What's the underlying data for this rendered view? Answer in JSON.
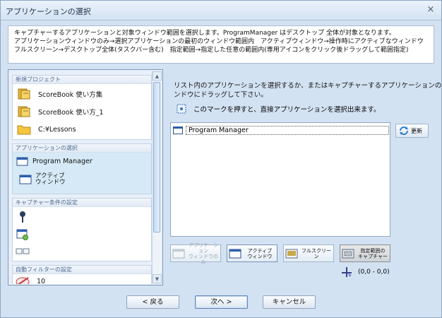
{
  "window": {
    "title": "アプリケーションの選択",
    "close_glyph": "×"
  },
  "description": [
    "キャプチャーするアプリケーションと対象ウィンドウ範囲を選択します。ProgramManager はデスクトップ 全体が対象となります。",
    "アプリケーションウィンドウのみ→選択アプリケーションの最初のウィンドウ範囲内　アクティブウィンドウ→操作時にアクティブなウィンドウ",
    "フルスクリーン→デスクトップ全体(タスクバー含む)　指定範囲→指定した任意の範囲内(専用アイコンをクリック後ドラッグして範囲指定)"
  ],
  "sidebar": {
    "new_project": {
      "header": "新規プロジェクト",
      "items": [
        {
          "label": "ScoreBook 使い方集",
          "icon": "book-icon"
        },
        {
          "label": "ScoreBook 使い方_1",
          "icon": "book-icon"
        },
        {
          "label": "C:¥Lessons",
          "icon": "folder-icon"
        }
      ]
    },
    "app_select": {
      "header": "アプリケーションの選択",
      "items": [
        {
          "label": "Program Manager",
          "icon": "window-icon"
        },
        {
          "label_line1": "アクティブ",
          "label_line2": "ウィンドウ",
          "icon": "active-window-icon"
        }
      ]
    },
    "capture_conditions": {
      "header": "キャプチャー条件の設定",
      "items": [
        {
          "icon": "pin-icon"
        },
        {
          "icon": "window-settings-icon"
        },
        {
          "icon": "keyboard-icon"
        }
      ]
    },
    "auto_filter": {
      "header": "自動フィルターの設定",
      "items": [
        {
          "label": "10",
          "icon": "no-filter-icon"
        }
      ]
    }
  },
  "main": {
    "instruction_line1": "リスト内のアプリケーションを選択するか、またはキャプチャーするアプリケーションのウィ",
    "instruction_line2": "ンドウにドラッグして下さい。",
    "hint": "このマークを押すと、直接アプリケーションを選択出来ます。",
    "app_list": [
      {
        "label": "Program Manager"
      }
    ],
    "refresh_label": "更新",
    "modes": [
      {
        "line1": "アプリケーション",
        "line2": "ウィンドウのみ",
        "state": "disabled"
      },
      {
        "line1": "アクティブ",
        "line2": "ウィンドウ",
        "state": "active"
      },
      {
        "line1": "フルスクリーン",
        "line2": "",
        "state": "normal"
      },
      {
        "line1": "指定範囲の",
        "line2": "キャプチャー",
        "state": "pressed"
      }
    ],
    "coords": "(0,0 - 0,0)"
  },
  "footer": {
    "back": "< 戻る",
    "next": "次へ >",
    "cancel": "キャンセル"
  }
}
